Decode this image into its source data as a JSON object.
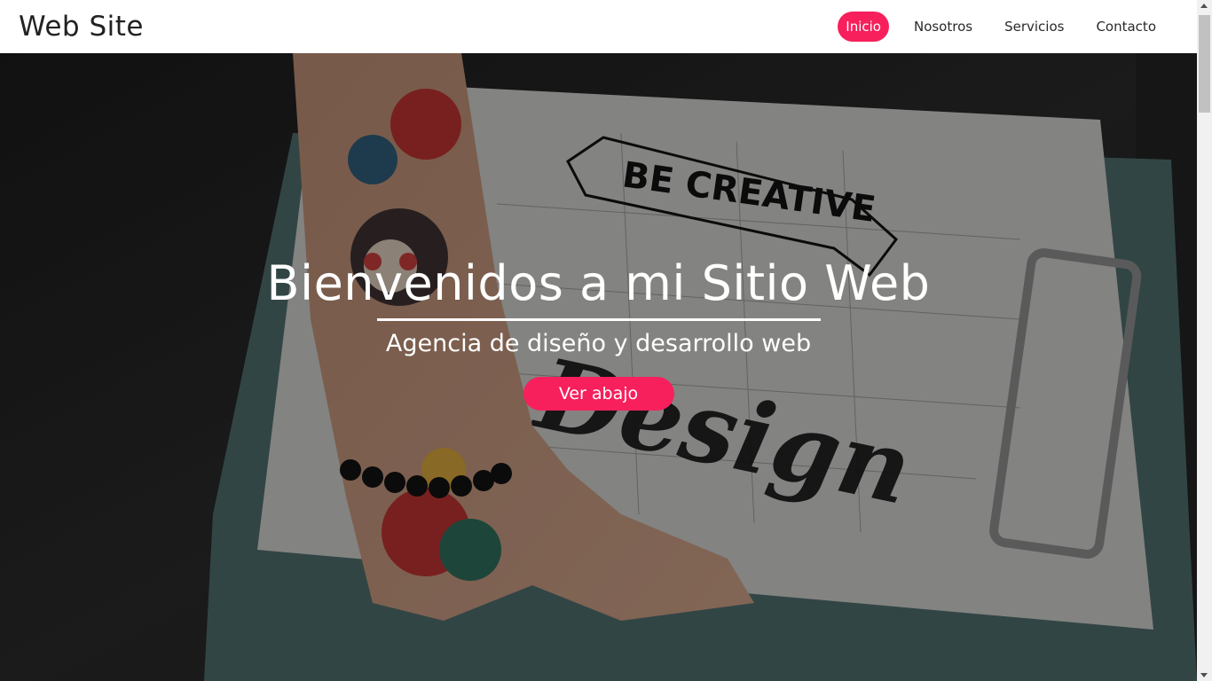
{
  "header": {
    "brand": "Web Site",
    "nav": [
      {
        "label": "Inicio",
        "active": true
      },
      {
        "label": "Nosotros",
        "active": false
      },
      {
        "label": "Servicios",
        "active": false
      },
      {
        "label": "Contacto",
        "active": false
      }
    ]
  },
  "hero": {
    "title": "Bienvenidos a mi Sitio Web",
    "subtitle": "Agencia de diseño y desarrollo web",
    "button_label": "Ver abajo",
    "image_text_banner": "BE CREATIVE",
    "image_text_script": "Design"
  },
  "colors": {
    "accent": "#f7205c",
    "header_bg": "#ffffff",
    "text_dark": "#222222"
  }
}
